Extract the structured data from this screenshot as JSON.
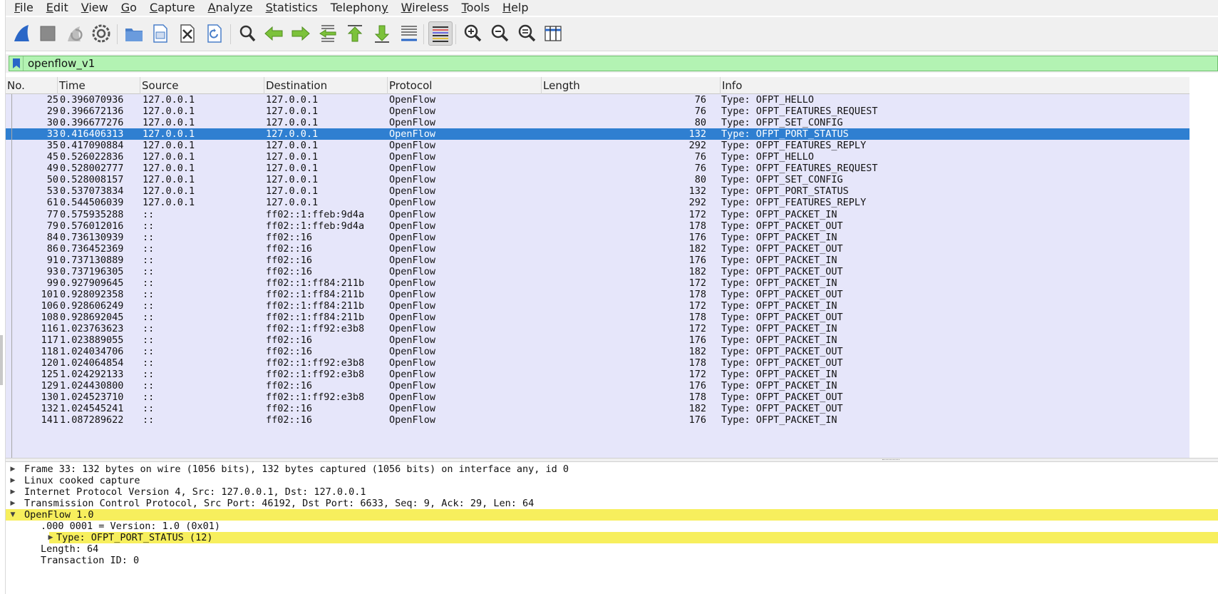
{
  "menu": [
    "File",
    "Edit",
    "View",
    "Go",
    "Capture",
    "Analyze",
    "Statistics",
    "Telephony",
    "Wireless",
    "Tools",
    "Help"
  ],
  "menu_mnemonics": [
    "F",
    "E",
    "V",
    "G",
    "C",
    "A",
    "S",
    "y",
    "W",
    "T",
    "H"
  ],
  "toolbar": {
    "icons": [
      "shark-fin-start-icon",
      "stop-square-icon",
      "restart-capture-icon",
      "capture-options-gear-icon",
      "open-folder-icon",
      "save-file-icon",
      "close-file-icon",
      "reload-file-icon",
      "find-packet-magnifier-icon",
      "go-back-arrow-icon",
      "go-forward-arrow-icon",
      "go-to-packet-icon",
      "go-to-first-packet-icon",
      "go-to-last-packet-icon",
      "autoscroll-icon",
      "colorize-lines-icon",
      "zoom-in-icon",
      "zoom-out-icon",
      "normal-size-icon",
      "resize-columns-icon"
    ],
    "active_icon": "colorize-lines-icon"
  },
  "filter": {
    "value": "openflow_v1",
    "bg_color": "#b3f3b3"
  },
  "columns": [
    "No.",
    "Time",
    "Source",
    "Destination",
    "Protocol",
    "Length",
    "Info"
  ],
  "packets": [
    {
      "no": "25",
      "time": "0.396070936",
      "source": "127.0.0.1",
      "destination": "127.0.0.1",
      "protocol": "OpenFlow",
      "length": "76",
      "info": "Type: OFPT_HELLO"
    },
    {
      "no": "29",
      "time": "0.396672136",
      "source": "127.0.0.1",
      "destination": "127.0.0.1",
      "protocol": "OpenFlow",
      "length": "76",
      "info": "Type: OFPT_FEATURES_REQUEST"
    },
    {
      "no": "30",
      "time": "0.396677276",
      "source": "127.0.0.1",
      "destination": "127.0.0.1",
      "protocol": "OpenFlow",
      "length": "80",
      "info": "Type: OFPT_SET_CONFIG"
    },
    {
      "no": "33",
      "time": "0.416406313",
      "source": "127.0.0.1",
      "destination": "127.0.0.1",
      "protocol": "OpenFlow",
      "length": "132",
      "info": "Type: OFPT_PORT_STATUS"
    },
    {
      "no": "35",
      "time": "0.417090884",
      "source": "127.0.0.1",
      "destination": "127.0.0.1",
      "protocol": "OpenFlow",
      "length": "292",
      "info": "Type: OFPT_FEATURES_REPLY"
    },
    {
      "no": "45",
      "time": "0.526022836",
      "source": "127.0.0.1",
      "destination": "127.0.0.1",
      "protocol": "OpenFlow",
      "length": "76",
      "info": "Type: OFPT_HELLO"
    },
    {
      "no": "49",
      "time": "0.528002777",
      "source": "127.0.0.1",
      "destination": "127.0.0.1",
      "protocol": "OpenFlow",
      "length": "76",
      "info": "Type: OFPT_FEATURES_REQUEST"
    },
    {
      "no": "50",
      "time": "0.528008157",
      "source": "127.0.0.1",
      "destination": "127.0.0.1",
      "protocol": "OpenFlow",
      "length": "80",
      "info": "Type: OFPT_SET_CONFIG"
    },
    {
      "no": "53",
      "time": "0.537073834",
      "source": "127.0.0.1",
      "destination": "127.0.0.1",
      "protocol": "OpenFlow",
      "length": "132",
      "info": "Type: OFPT_PORT_STATUS"
    },
    {
      "no": "61",
      "time": "0.544506039",
      "source": "127.0.0.1",
      "destination": "127.0.0.1",
      "protocol": "OpenFlow",
      "length": "292",
      "info": "Type: OFPT_FEATURES_REPLY"
    },
    {
      "no": "77",
      "time": "0.575935288",
      "source": "::",
      "destination": "ff02::1:ffeb:9d4a",
      "protocol": "OpenFlow",
      "length": "172",
      "info": "Type: OFPT_PACKET_IN"
    },
    {
      "no": "79",
      "time": "0.576012016",
      "source": "::",
      "destination": "ff02::1:ffeb:9d4a",
      "protocol": "OpenFlow",
      "length": "178",
      "info": "Type: OFPT_PACKET_OUT"
    },
    {
      "no": "84",
      "time": "0.736130939",
      "source": "::",
      "destination": "ff02::16",
      "protocol": "OpenFlow",
      "length": "176",
      "info": "Type: OFPT_PACKET_IN"
    },
    {
      "no": "86",
      "time": "0.736452369",
      "source": "::",
      "destination": "ff02::16",
      "protocol": "OpenFlow",
      "length": "182",
      "info": "Type: OFPT_PACKET_OUT"
    },
    {
      "no": "91",
      "time": "0.737130889",
      "source": "::",
      "destination": "ff02::16",
      "protocol": "OpenFlow",
      "length": "176",
      "info": "Type: OFPT_PACKET_IN"
    },
    {
      "no": "93",
      "time": "0.737196305",
      "source": "::",
      "destination": "ff02::16",
      "protocol": "OpenFlow",
      "length": "182",
      "info": "Type: OFPT_PACKET_OUT"
    },
    {
      "no": "99",
      "time": "0.927909645",
      "source": "::",
      "destination": "ff02::1:ff84:211b",
      "protocol": "OpenFlow",
      "length": "172",
      "info": "Type: OFPT_PACKET_IN"
    },
    {
      "no": "101",
      "time": "0.928092358",
      "source": "::",
      "destination": "ff02::1:ff84:211b",
      "protocol": "OpenFlow",
      "length": "178",
      "info": "Type: OFPT_PACKET_OUT"
    },
    {
      "no": "106",
      "time": "0.928606249",
      "source": "::",
      "destination": "ff02::1:ff84:211b",
      "protocol": "OpenFlow",
      "length": "172",
      "info": "Type: OFPT_PACKET_IN"
    },
    {
      "no": "108",
      "time": "0.928692045",
      "source": "::",
      "destination": "ff02::1:ff84:211b",
      "protocol": "OpenFlow",
      "length": "178",
      "info": "Type: OFPT_PACKET_OUT"
    },
    {
      "no": "116",
      "time": "1.023763623",
      "source": "::",
      "destination": "ff02::1:ff92:e3b8",
      "protocol": "OpenFlow",
      "length": "172",
      "info": "Type: OFPT_PACKET_IN"
    },
    {
      "no": "117",
      "time": "1.023889055",
      "source": "::",
      "destination": "ff02::16",
      "protocol": "OpenFlow",
      "length": "176",
      "info": "Type: OFPT_PACKET_IN"
    },
    {
      "no": "118",
      "time": "1.024034706",
      "source": "::",
      "destination": "ff02::16",
      "protocol": "OpenFlow",
      "length": "182",
      "info": "Type: OFPT_PACKET_OUT"
    },
    {
      "no": "120",
      "time": "1.024064854",
      "source": "::",
      "destination": "ff02::1:ff92:e3b8",
      "protocol": "OpenFlow",
      "length": "178",
      "info": "Type: OFPT_PACKET_OUT"
    },
    {
      "no": "125",
      "time": "1.024292133",
      "source": "::",
      "destination": "ff02::1:ff92:e3b8",
      "protocol": "OpenFlow",
      "length": "172",
      "info": "Type: OFPT_PACKET_IN"
    },
    {
      "no": "129",
      "time": "1.024430800",
      "source": "::",
      "destination": "ff02::16",
      "protocol": "OpenFlow",
      "length": "176",
      "info": "Type: OFPT_PACKET_IN"
    },
    {
      "no": "130",
      "time": "1.024523710",
      "source": "::",
      "destination": "ff02::1:ff92:e3b8",
      "protocol": "OpenFlow",
      "length": "178",
      "info": "Type: OFPT_PACKET_OUT"
    },
    {
      "no": "132",
      "time": "1.024545241",
      "source": "::",
      "destination": "ff02::16",
      "protocol": "OpenFlow",
      "length": "182",
      "info": "Type: OFPT_PACKET_OUT"
    },
    {
      "no": "141",
      "time": "1.087289622",
      "source": "::",
      "destination": "ff02::16",
      "protocol": "OpenFlow",
      "length": "176",
      "info": "Type: OFPT_PACKET_IN"
    }
  ],
  "selected_packet_no": "33",
  "colors": {
    "row_bg": "#e6e6fa",
    "selected_bg": "#2f7fd1",
    "highlight_bg": "#f7ef5d"
  },
  "details": [
    {
      "text": "Frame 33: 132 bytes on wire (1056 bits), 132 bytes captured (1056 bits) on interface any, id 0",
      "expander": "collapsed",
      "level": 0,
      "highlight": false
    },
    {
      "text": "Linux cooked capture",
      "expander": "collapsed",
      "level": 0,
      "highlight": false
    },
    {
      "text": "Internet Protocol Version 4, Src: 127.0.0.1, Dst: 127.0.0.1",
      "expander": "collapsed",
      "level": 0,
      "highlight": false
    },
    {
      "text": "Transmission Control Protocol, Src Port: 46192, Dst Port: 6633, Seq: 9, Ack: 29, Len: 64",
      "expander": "collapsed",
      "level": 0,
      "highlight": false
    },
    {
      "text": "OpenFlow 1.0",
      "expander": "expanded",
      "level": 0,
      "highlight": true
    },
    {
      "text": ".000 0001 = Version: 1.0 (0x01)",
      "expander": "none",
      "level": 1,
      "highlight": false
    },
    {
      "text": "Type: OFPT_PORT_STATUS (12)",
      "expander": "collapsed",
      "level": 1,
      "highlight": true
    },
    {
      "text": "Length: 64",
      "expander": "none",
      "level": 1,
      "highlight": false
    },
    {
      "text": "Transaction ID: 0",
      "expander": "none",
      "level": 1,
      "highlight": false
    }
  ]
}
